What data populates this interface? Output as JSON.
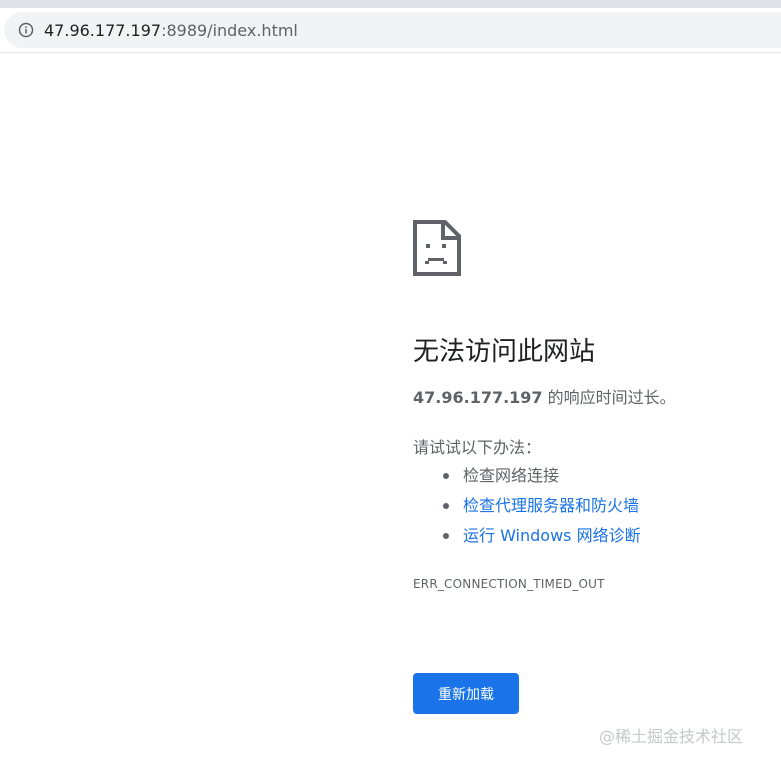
{
  "address_bar": {
    "host": "47.96.177.197",
    "rest": ":8989/index.html"
  },
  "error_page": {
    "heading": "无法访问此网站",
    "summary_host": "47.96.177.197",
    "summary_text": " 的响应时间过长。",
    "suggest_title": "请试试以下办法：",
    "suggestions": [
      {
        "label": "检查网络连接",
        "link": false
      },
      {
        "label": "检查代理服务器和防火墙",
        "link": true
      },
      {
        "label": "运行 Windows 网络诊断",
        "link": true
      }
    ],
    "error_code": "ERR_CONNECTION_TIMED_OUT",
    "reload_label": "重新加载"
  },
  "watermark": "@稀土掘金技术社区",
  "icons": {
    "address_info": "info-icon",
    "page": "sad-page-icon"
  },
  "colors": {
    "link": "#1a73e8",
    "button": "#1a73e8",
    "text": "#5f6368",
    "heading": "#202124"
  }
}
